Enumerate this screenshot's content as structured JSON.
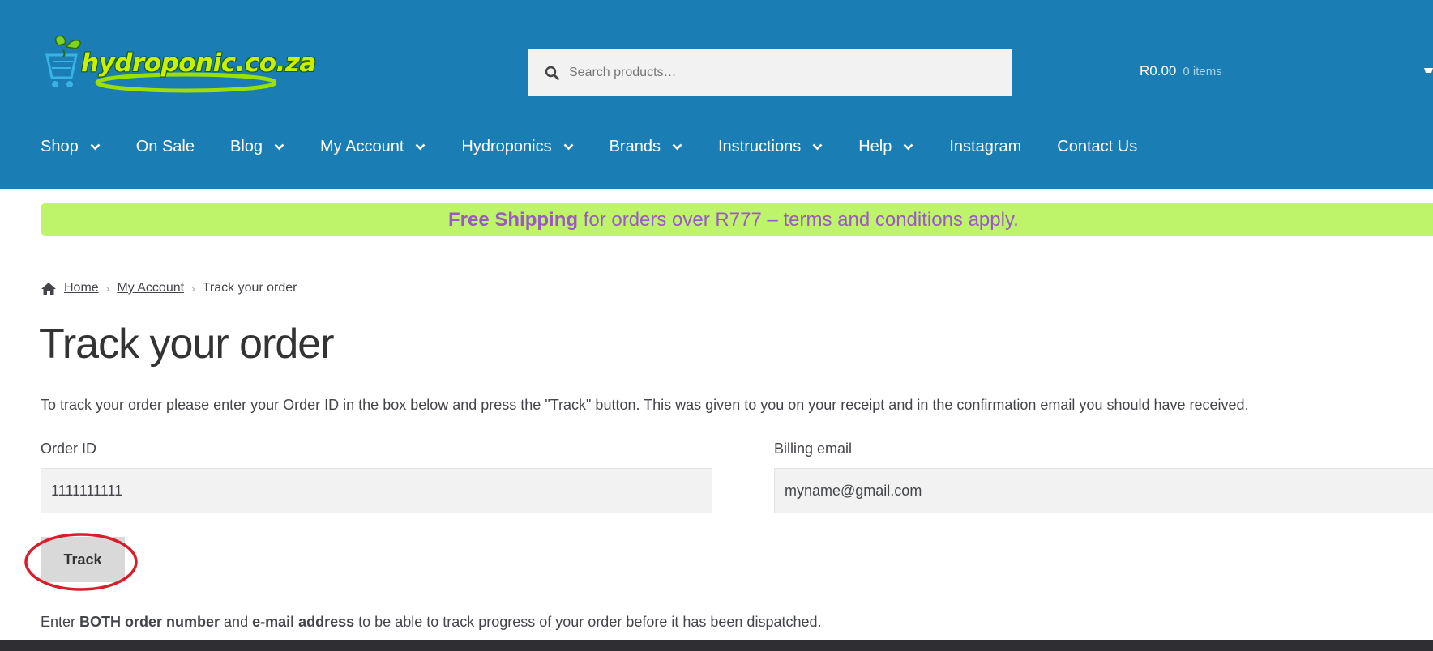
{
  "header": {
    "logo_text": "hydroponic.co.za",
    "search": {
      "placeholder": "Search products…"
    },
    "cart": {
      "total": "R0.00",
      "items": "0 items"
    }
  },
  "nav": {
    "items": [
      {
        "label": "Shop",
        "has_dropdown": true
      },
      {
        "label": "On Sale",
        "has_dropdown": false
      },
      {
        "label": "Blog",
        "has_dropdown": true
      },
      {
        "label": "My Account",
        "has_dropdown": true
      },
      {
        "label": "Hydroponics",
        "has_dropdown": true
      },
      {
        "label": "Brands",
        "has_dropdown": true
      },
      {
        "label": "Instructions",
        "has_dropdown": true
      },
      {
        "label": "Help",
        "has_dropdown": true
      },
      {
        "label": "Instagram",
        "has_dropdown": false
      },
      {
        "label": "Contact Us",
        "has_dropdown": false
      }
    ]
  },
  "promo": {
    "highlight": "Free Shipping",
    "text": " for orders over R777 – terms and conditions apply."
  },
  "breadcrumb": {
    "home": "Home",
    "account": "My Account",
    "current": "Track your order"
  },
  "page": {
    "title": "Track your order",
    "intro": "To track your order please enter your Order ID in the box below and press the \"Track\" button. This was given to you on your receipt and in the confirmation email you should have received."
  },
  "form": {
    "order_id_label": "Order ID",
    "order_id_value": "1111111111",
    "email_label": "Billing email",
    "email_value": "myname@gmail.com",
    "track_label": "Track"
  },
  "note": {
    "prefix": "Enter ",
    "bold1": "BOTH order number",
    "mid": " and ",
    "bold2": "e-mail address",
    "suffix": " to be able to track progress of your order before it has been dispatched."
  },
  "colors": {
    "header_bg": "#1a7db3",
    "promo_bg": "#bdf46a",
    "promo_text": "#9b59c8",
    "annotation": "#d81e2a"
  },
  "icons": [
    "logo-basket-icon",
    "search-icon",
    "cart-icon",
    "chevron-down-icon",
    "home-icon"
  ]
}
